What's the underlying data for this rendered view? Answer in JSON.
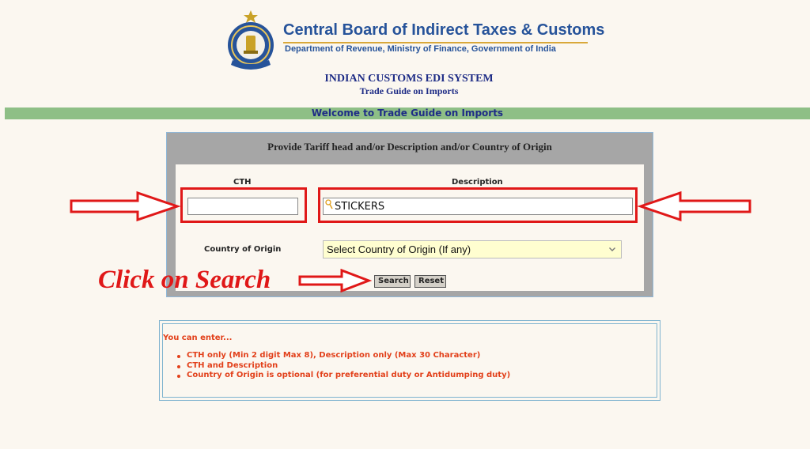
{
  "header": {
    "org_title": "Central Board of Indirect Taxes & Customs",
    "org_subtitle": "Department of Revenue, Ministry of Finance, Government of India",
    "system_title": "INDIAN CUSTOMS EDI SYSTEM",
    "system_subtitle": "Trade Guide on Imports",
    "welcome": "Welcome to Trade Guide on Imports"
  },
  "form": {
    "heading": "Provide Tariff head and/or Description and/or Country of Origin",
    "cth_label": "CTH",
    "cth_value": "",
    "description_label": "Description",
    "description_value": "STICKERS",
    "country_label": "Country of Origin",
    "country_selected": "Select Country of Origin (If any)",
    "search_label": "Search",
    "reset_label": "Reset"
  },
  "annotation": {
    "click_note": "Click on Search",
    "color": "#e01818"
  },
  "info": {
    "title": "You can enter...",
    "items": [
      "CTH only (Min 2 digit Max 8), Description only (Max 30 Character)",
      "CTH and Description",
      "Country of Origin is optional (for preferential duty or Antidumping duty)"
    ]
  },
  "colors": {
    "brand_blue": "#26539a",
    "welcome_bar": "#8ebf86",
    "panel_gray": "#a6a6a6",
    "info_red": "#e2401a"
  },
  "icons": {
    "logo": "cbic-emblem-logo",
    "dropdown": "chevron-down-icon",
    "arrows": "red-outline-arrow-icon"
  }
}
